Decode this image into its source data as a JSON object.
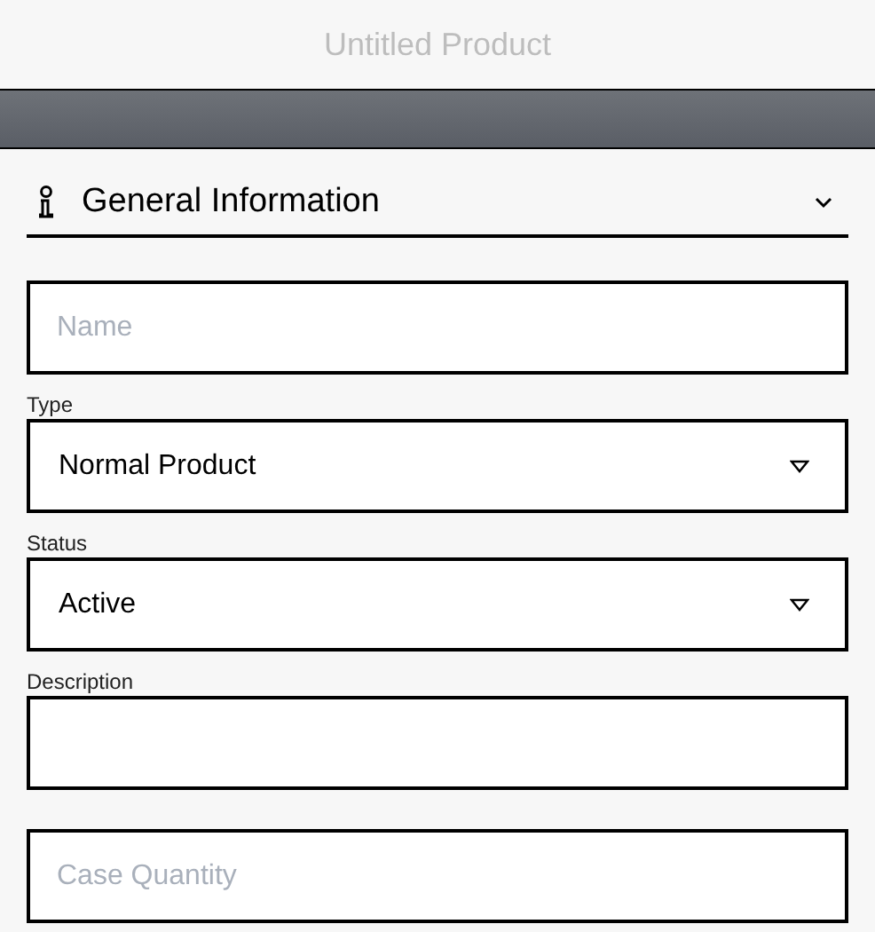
{
  "header": {
    "title": "Untitled Product"
  },
  "section": {
    "title": "General Information",
    "expanded": true
  },
  "fields": [
    {
      "kind": "text",
      "placeholder": "Name"
    },
    {
      "kind": "select",
      "label": "Type",
      "value": "Normal Product"
    },
    {
      "kind": "select",
      "label": "Status",
      "value": "Active"
    },
    {
      "kind": "textarea",
      "label": "Description"
    },
    {
      "kind": "text",
      "placeholder": "Case Quantity"
    }
  ]
}
